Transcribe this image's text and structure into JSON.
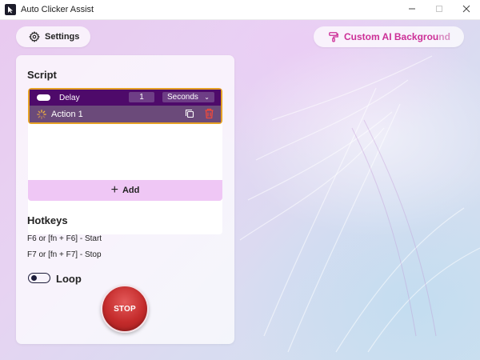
{
  "window": {
    "title": "Auto Clicker Assist",
    "icon": "app-logo-icon",
    "controls": [
      "minimize-icon",
      "maximize-icon",
      "close-icon"
    ]
  },
  "toolbar": {
    "settings_label": "Settings",
    "settings_icon": "gear-icon",
    "custom_bg_label": "Custom AI Backgrou",
    "custom_bg_label_fade": "nd",
    "custom_bg_icon": "paint-roller-icon",
    "custom_bg_color": "#cc2f97"
  },
  "script": {
    "title": "Script",
    "delay": {
      "label": "Delay",
      "value": "1",
      "unit": "Seconds",
      "enabled": true
    },
    "actions": [
      {
        "label": "Action 1",
        "status": "running"
      }
    ],
    "add_label": "Add",
    "accent_color": "#e6a126",
    "row_color": "#4e0a6a"
  },
  "hotkeys": {
    "title": "Hotkeys",
    "start": "F6 or [fn + F6] - Start",
    "stop": "F7 or [fn + F7] - Stop"
  },
  "loop": {
    "label": "Loop",
    "enabled": false
  },
  "stop_button": {
    "label": "STOP",
    "color": "#c42b2b"
  }
}
